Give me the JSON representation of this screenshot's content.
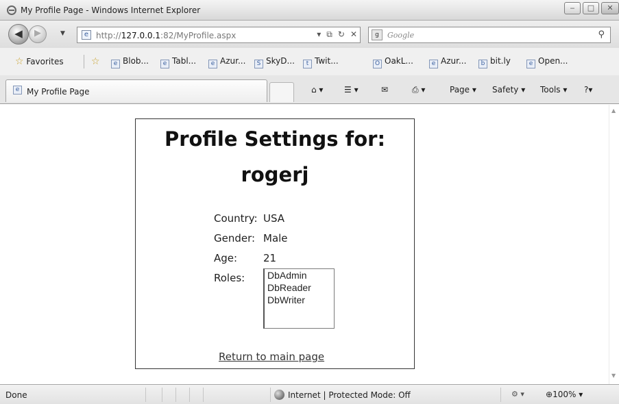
{
  "window": {
    "title": "My Profile Page - Windows Internet Explorer"
  },
  "address_bar": {
    "url_prefix": "http://",
    "url_host": "127.0.0.1",
    "url_rest": ":82/MyProfile.aspx"
  },
  "search": {
    "engine": "Google"
  },
  "favorites_bar": {
    "favorites_label": "Favorites",
    "links": [
      "Blob...",
      "Tabl...",
      "Azur...",
      "SkyD...",
      "Twit...",
      "OakL...",
      "Azur...",
      "bit.ly",
      "Open..."
    ]
  },
  "tab": {
    "label": "My Profile Page"
  },
  "command_bar": {
    "page": "Page",
    "safety": "Safety",
    "tools": "Tools"
  },
  "page": {
    "heading_line1": "Profile Settings for:",
    "heading_line2": "rogerj",
    "fields": [
      {
        "label": "Country:",
        "value": "USA"
      },
      {
        "label": "Gender:",
        "value": "Male"
      },
      {
        "label": "Age:",
        "value": "21"
      }
    ],
    "roles_label": "Roles:",
    "roles": [
      "DbAdmin",
      "DbReader",
      "DbWriter"
    ],
    "return_link": "Return to main page"
  },
  "status_bar": {
    "status": "Done",
    "zone": "Internet | Protected Mode: Off",
    "zoom": "100%"
  }
}
